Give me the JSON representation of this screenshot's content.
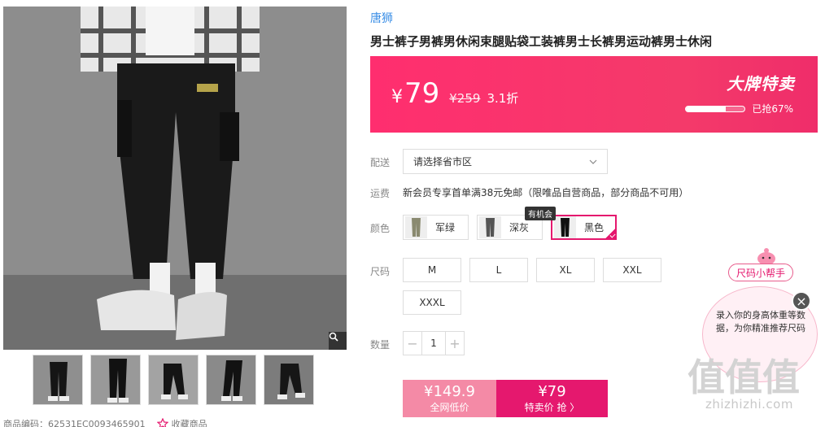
{
  "brand": "唐狮",
  "title": "男士裤子男裤男休闲束腿贴袋工装裤男士长裤男运动裤男士休闲",
  "price_banner": {
    "currency": "¥",
    "price": "79",
    "original_price": "¥259",
    "discount": "3.1折",
    "promo_name": "大牌特卖",
    "sold_label": "已抢67%",
    "sold_fraction": 0.67,
    "gradient_color": "#ff2e6f"
  },
  "shipping": {
    "label": "配送",
    "select_placeholder": "请选择省市区"
  },
  "freight": {
    "label": "运费",
    "text": "新会员专享首单满38元免邮（限唯品自营商品，部分商品不可用）"
  },
  "colors": {
    "label": "颜色",
    "tag": "有机会",
    "options": [
      {
        "name": "军绿",
        "selected": false
      },
      {
        "name": "深灰",
        "selected": false
      },
      {
        "name": "黑色",
        "selected": true
      }
    ]
  },
  "sizes": {
    "label": "尺码",
    "options": [
      "M",
      "L",
      "XL",
      "XXL",
      "XXXL"
    ]
  },
  "quantity": {
    "label": "数量",
    "value": "1",
    "minus": "−",
    "plus": "+"
  },
  "buy": {
    "left_price": "¥149.9",
    "left_label": "全网低价",
    "right_price": "¥79",
    "right_label": "特卖价 抢 〉",
    "accent": "#e5186e"
  },
  "helper": {
    "title": "尺码小帮手",
    "text": "录入你的身高体重等数据，为你精准推荐尺码",
    "close": "×"
  },
  "meta": {
    "code": "商品编码：62531EC0093465901",
    "favorite": "收藏商品"
  },
  "watermark": {
    "logo": "值值值",
    "url": "zhizhizhi.com"
  }
}
